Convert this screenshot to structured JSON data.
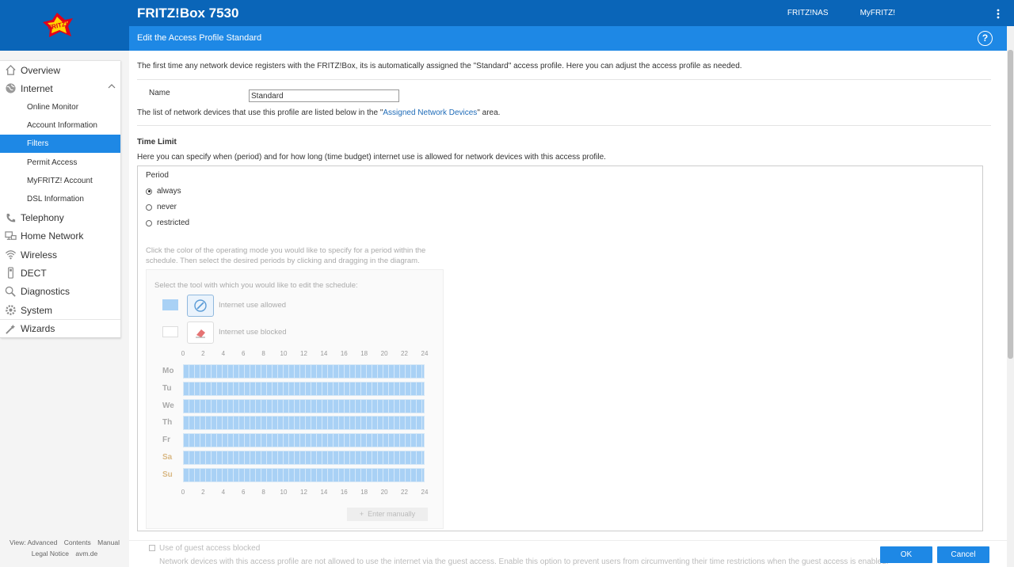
{
  "product": "FRITZ!Box 7530",
  "logo_text": "FRITZ!",
  "topbar_links": [
    "FRITZ!NAS",
    "MyFRITZ!"
  ],
  "page_title": "Edit the Access Profile Standard",
  "help_label": "?",
  "nav": {
    "overview": "Overview",
    "internet": "Internet",
    "online_monitor": "Online Monitor",
    "account_information": "Account Information",
    "filters": "Filters",
    "permit_access": "Permit Access",
    "myfritz_account": "MyFRITZ! Account",
    "dsl_information": "DSL Information",
    "telephony": "Telephony",
    "home_network": "Home Network",
    "wireless": "Wireless",
    "dect": "DECT",
    "diagnostics": "Diagnostics",
    "system": "System",
    "wizards": "Wizards"
  },
  "footer_links": {
    "view": "View: Advanced",
    "contents": "Contents",
    "manual": "Manual",
    "legal": "Legal Notice",
    "avm": "avm.de"
  },
  "intro": "The first time any network device registers with the FRITZ!Box, its is automatically assigned the \"Standard\" access profile. Here you can adjust the access profile as needed.",
  "name_label": "Name",
  "name_value": "Standard",
  "devices_text_pre": "The list of network devices that use this profile are listed below in the \"",
  "devices_link": "Assigned Network Devices",
  "devices_text_post": "\" area.",
  "time_limit_heading": "Time Limit",
  "time_limit_desc": "Here you can specify when (period) and for how long (time budget) internet use is allowed for network devices with this access profile.",
  "period_label": "Period",
  "period_options": {
    "always": "always",
    "never": "never",
    "restricted": "restricted"
  },
  "period_selected": "always",
  "schedule_hint": "Click the color of the operating mode you would like to specify for a period within the schedule. Then select the desired periods by clicking and dragging in the diagram.",
  "tool_hint": "Select the tool with which you would like to edit the schedule:",
  "tool_allowed": "Internet use allowed",
  "tool_blocked": "Internet use blocked",
  "hours": [
    "0",
    "2",
    "4",
    "6",
    "8",
    "10",
    "12",
    "14",
    "16",
    "18",
    "20",
    "22",
    "24"
  ],
  "days": [
    "Mo",
    "Tu",
    "We",
    "Th",
    "Fr",
    "Sa",
    "Su"
  ],
  "enter_manually": "Enter manually",
  "guest_label": "Use of guest access blocked",
  "guest_desc": "Network devices with this access profile are not allowed to use the internet via the guest access. Enable this option to prevent users from circumventing their time restrictions when the guest access is enabled.",
  "ok": "OK",
  "cancel": "Cancel",
  "colors": {
    "topbar": "#0a65b8",
    "subbar": "#1e88e5",
    "allowed": "#a9d1f5",
    "weekend": "#d9b884"
  }
}
